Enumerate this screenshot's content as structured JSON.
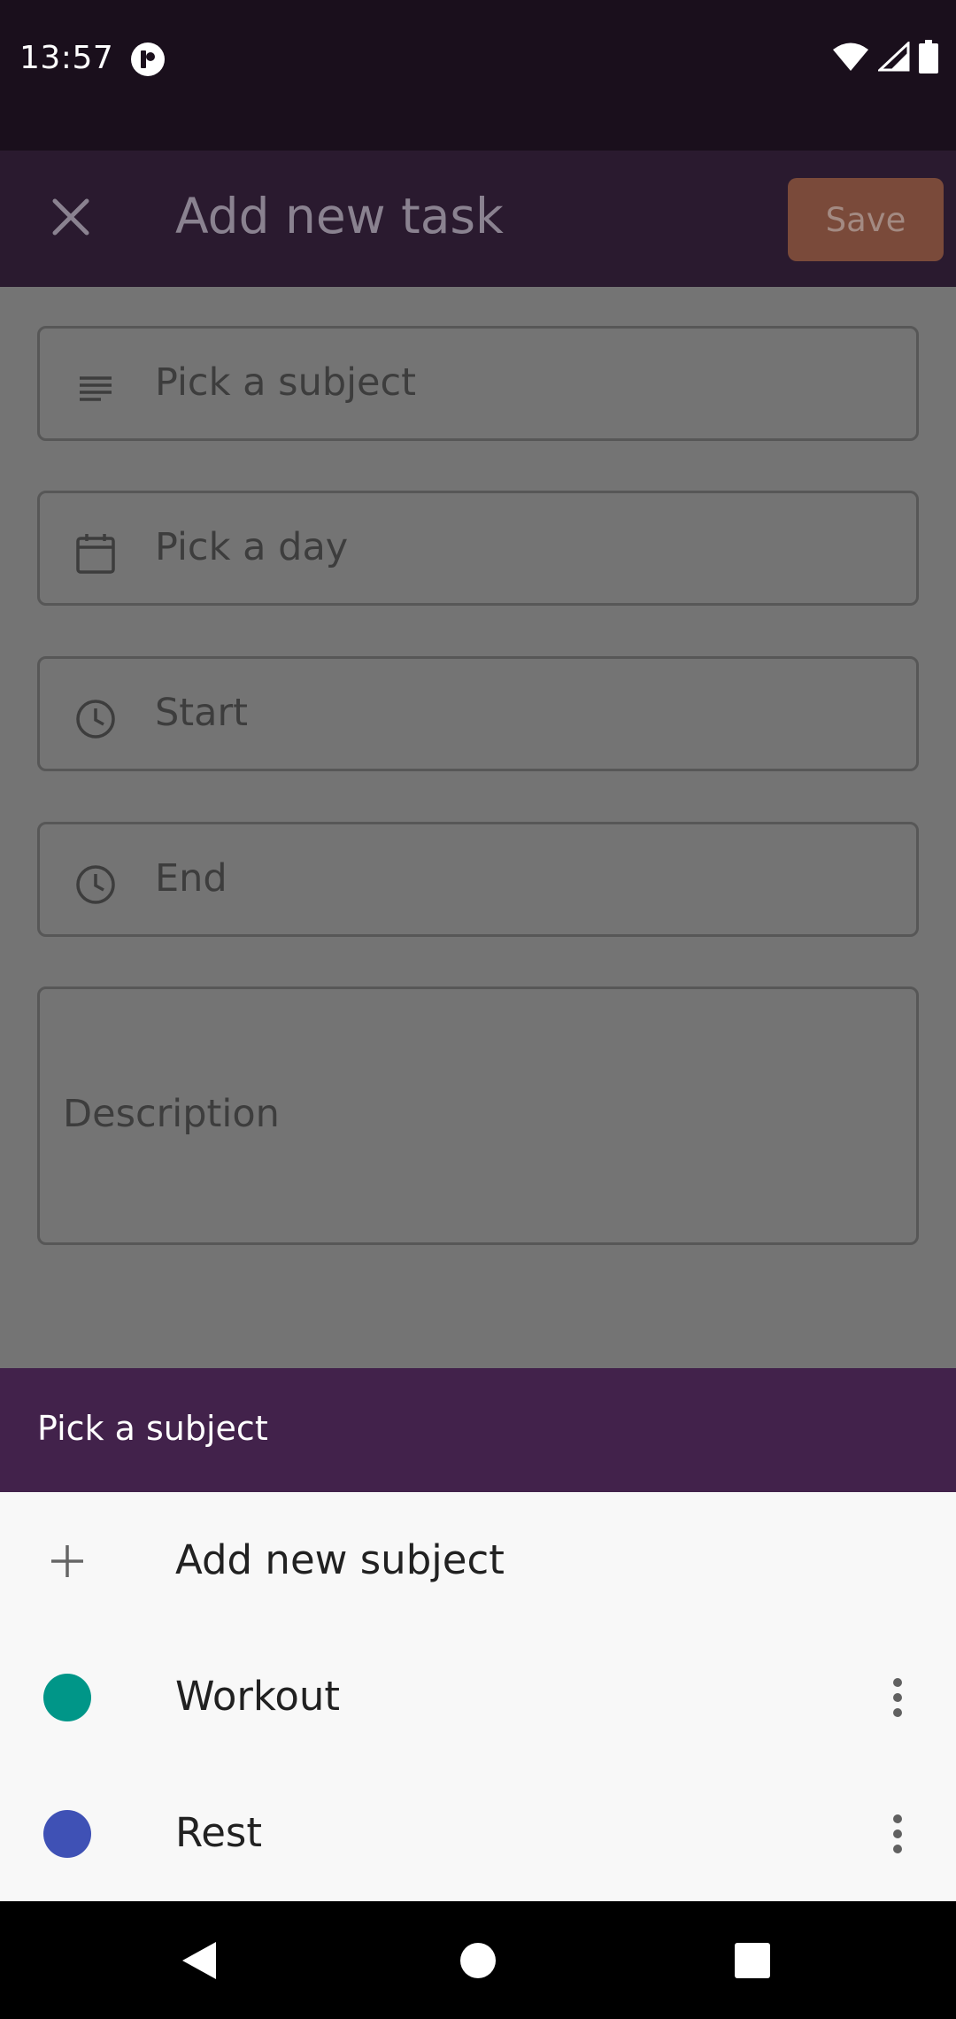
{
  "status_bar": {
    "time": "13:57",
    "icons": [
      "app-notification-icon",
      "wifi-icon",
      "signal-icon",
      "battery-icon"
    ]
  },
  "app_bar": {
    "title": "Add new task",
    "save_label": "Save",
    "close_icon": "close-icon"
  },
  "form": {
    "subject_placeholder": "Pick a subject",
    "day_placeholder": "Pick a day",
    "start_placeholder": "Start",
    "end_placeholder": "End",
    "description_placeholder": "Description"
  },
  "sheet": {
    "title": "Pick a subject",
    "add_label": "Add new subject",
    "subjects": [
      {
        "label": "Workout",
        "color": "#009688"
      },
      {
        "label": "Rest",
        "color": "#3f51b5"
      }
    ]
  },
  "colors": {
    "status_bar": "#1a0f1c",
    "app_bar": "#2a1a2f",
    "save_button": "#7a4a3a",
    "sheet_header": "#42224b",
    "scrim": "#747474"
  }
}
